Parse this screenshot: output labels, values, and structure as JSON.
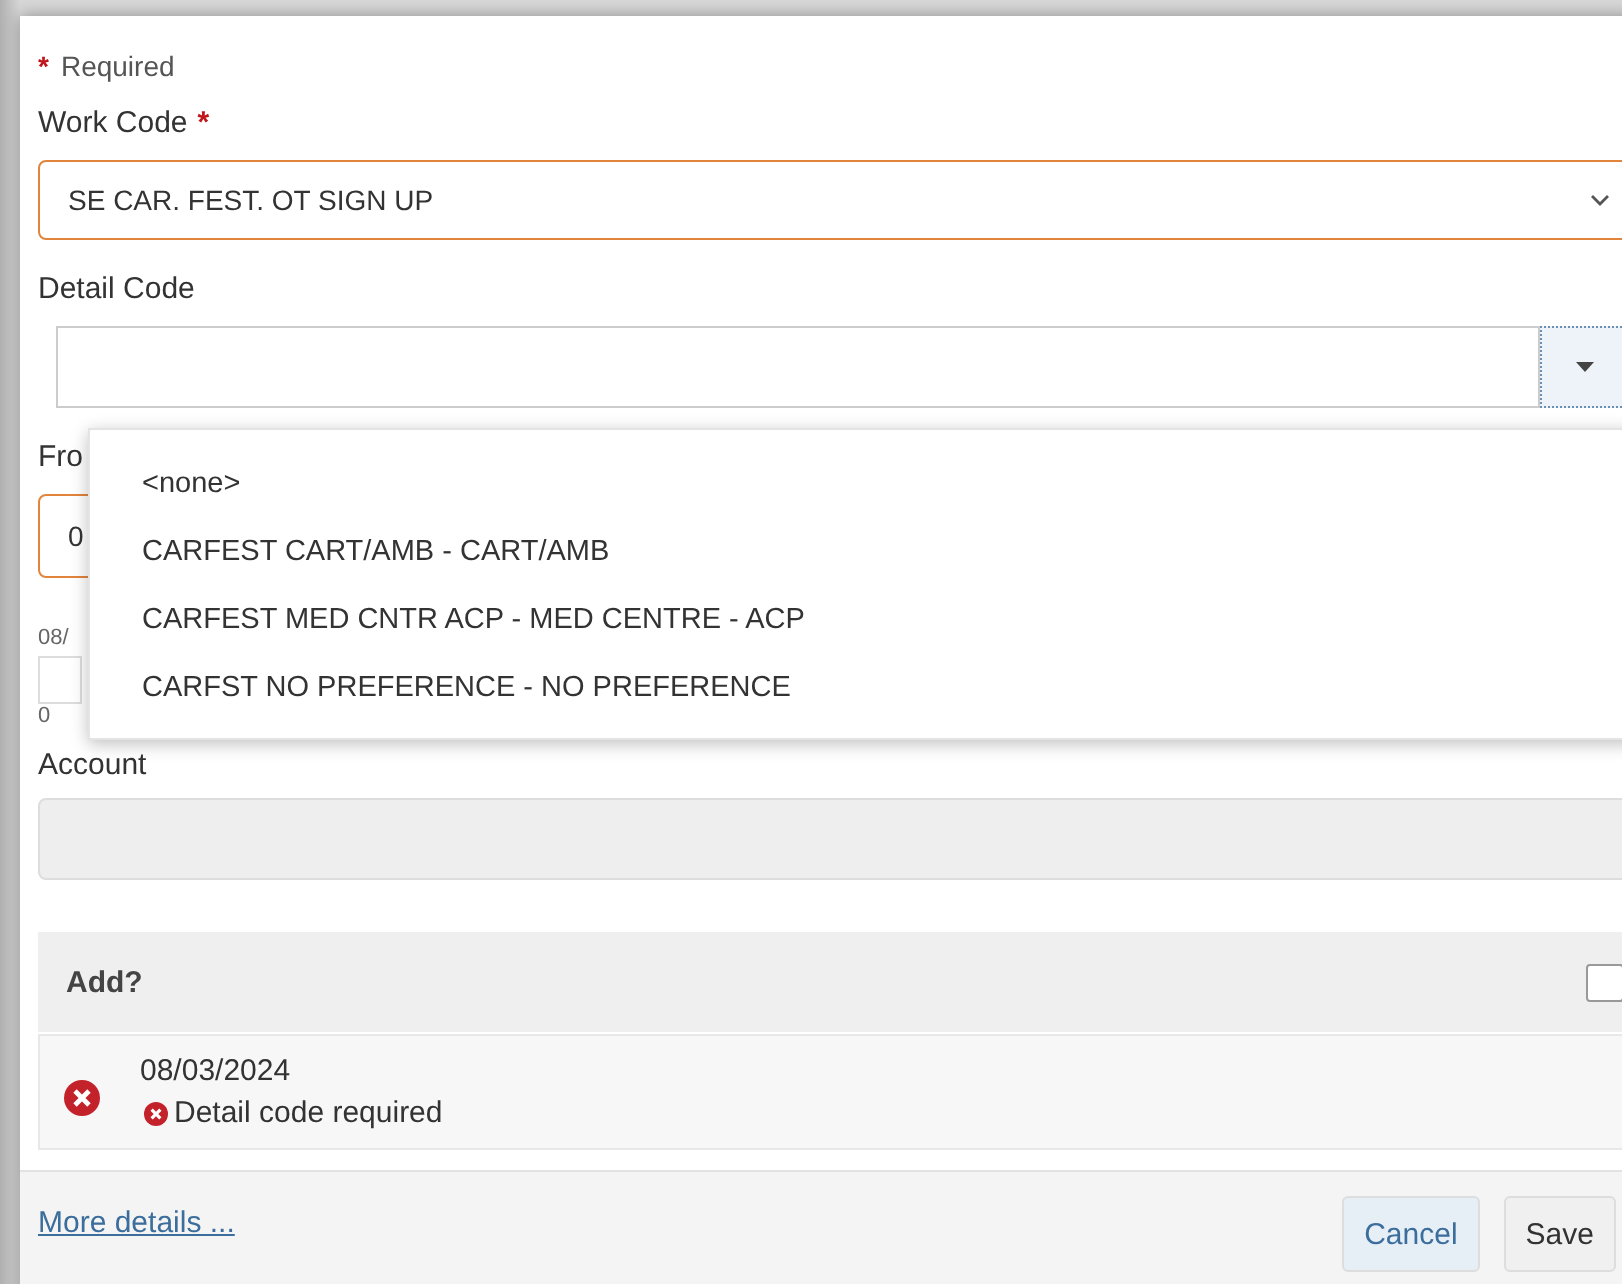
{
  "required_note": {
    "marker": "*",
    "text": "Required"
  },
  "work_code": {
    "label": "Work Code",
    "required_marker": "*",
    "value": "SE CAR. FEST. OT SIGN UP",
    "invalid": true
  },
  "detail_code": {
    "label": "Detail Code",
    "expanded": true,
    "options": [
      {
        "label": "<none>",
        "selected": false
      },
      {
        "label": "CARFEST CART/AMB - CART/AMB",
        "selected": false
      },
      {
        "label": "CARFEST MED CNTR ACP - MED CENTRE - ACP",
        "selected": false
      },
      {
        "label": "CARFST NO PREFERENCE - NO PREFERENCE",
        "selected": false
      }
    ]
  },
  "from": {
    "label": "Fro",
    "value": "0",
    "invalid": true
  },
  "partial_row": {
    "date": "08/",
    "count": "0"
  },
  "account": {
    "label": "Account",
    "disabled": true
  },
  "add_section": {
    "label": "Add?",
    "checked": false
  },
  "errors": [
    {
      "date": "08/03/2024",
      "message": "Detail code required"
    }
  ],
  "footer": {
    "link": "More details ...",
    "buttons": [
      {
        "label": "Cancel",
        "kind": "primary"
      },
      {
        "label": "Save",
        "kind": "plain"
      }
    ]
  }
}
